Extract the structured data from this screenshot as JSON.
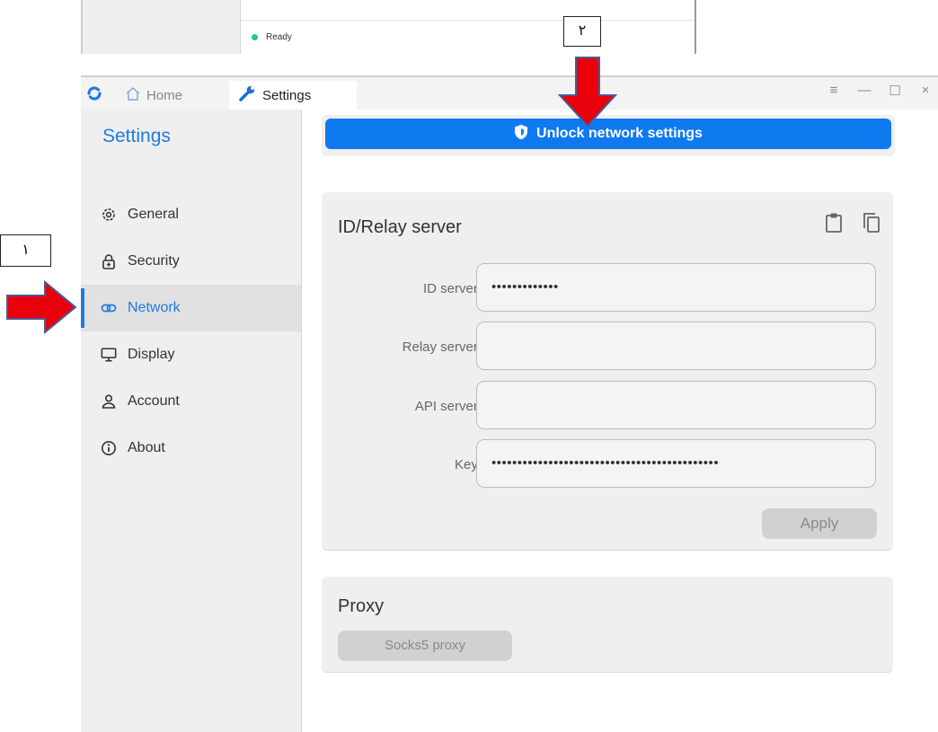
{
  "top_snippet": {
    "status_text": "Ready"
  },
  "callouts": {
    "one": "١",
    "two": "٢"
  },
  "tabs": [
    {
      "label": "Home",
      "icon": "home-icon"
    },
    {
      "label": "Settings",
      "icon": "wrench-icon"
    }
  ],
  "window_controls": {
    "menu": "≡",
    "minimize": "—",
    "maximize": "☐",
    "close": "×"
  },
  "sidebar": {
    "title": "Settings",
    "items": [
      {
        "label": "General",
        "icon": "gear-icon"
      },
      {
        "label": "Security",
        "icon": "lock-icon"
      },
      {
        "label": "Network",
        "icon": "link-icon",
        "active": true
      },
      {
        "label": "Display",
        "icon": "monitor-icon"
      },
      {
        "label": "Account",
        "icon": "user-icon"
      },
      {
        "label": "About",
        "icon": "info-icon"
      }
    ]
  },
  "unlock": {
    "label": "Unlock network settings",
    "icon": "shield-icon"
  },
  "relay": {
    "title": "ID/Relay server",
    "fields": [
      {
        "label": "ID server:",
        "value": "•••••••••••••"
      },
      {
        "label": "Relay server:",
        "value": ""
      },
      {
        "label": "API server:",
        "value": ""
      },
      {
        "label": "Key:",
        "value": "••••••••••••••••••••••••••••••••••••••••••••"
      }
    ],
    "apply_label": "Apply"
  },
  "proxy": {
    "title": "Proxy",
    "button_label": "Socks5 proxy"
  },
  "colors": {
    "accent": "#1f7ae0",
    "button_blue": "#0f79f0",
    "arrow_red": "#e8000b",
    "status_green": "#22c39a"
  }
}
